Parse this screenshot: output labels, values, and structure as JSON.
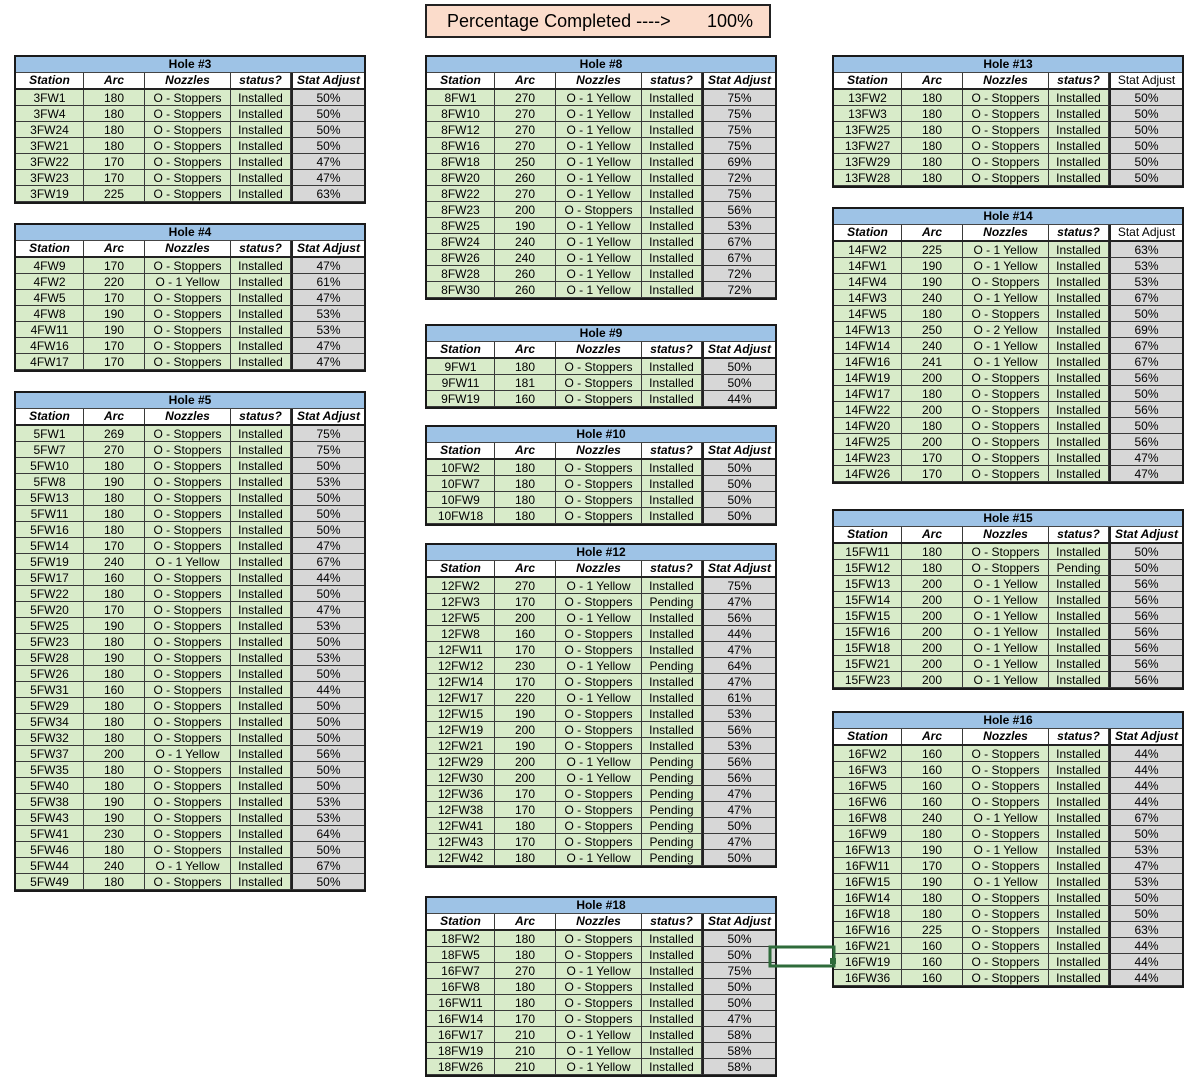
{
  "banner": {
    "label": "Percentage Completed ---->",
    "value": "100%"
  },
  "columns": [
    "Station",
    "Arc",
    "Nozzles",
    "status?",
    "Stat Adjust"
  ],
  "holes": [
    {
      "title": "Hole #3",
      "adj_header_plain": false,
      "rows": [
        [
          "3FW1",
          "180",
          "O - Stoppers",
          "Installed",
          "50%"
        ],
        [
          "3FW4",
          "180",
          "O - Stoppers",
          "Installed",
          "50%"
        ],
        [
          "3FW24",
          "180",
          "O - Stoppers",
          "Installed",
          "50%"
        ],
        [
          "3FW21",
          "180",
          "O - Stoppers",
          "Installed",
          "50%"
        ],
        [
          "3FW22",
          "170",
          "O - Stoppers",
          "Installed",
          "47%"
        ],
        [
          "3FW23",
          "170",
          "O - Stoppers",
          "Installed",
          "47%"
        ],
        [
          "3FW19",
          "225",
          "O - Stoppers",
          "Installed",
          "63%"
        ]
      ]
    },
    {
      "title": "Hole #4",
      "adj_header_plain": false,
      "rows": [
        [
          "4FW9",
          "170",
          "O - Stoppers",
          "Installed",
          "47%"
        ],
        [
          "4FW2",
          "220",
          "O - 1 Yellow",
          "Installed",
          "61%"
        ],
        [
          "4FW5",
          "170",
          "O - Stoppers",
          "Installed",
          "47%"
        ],
        [
          "4FW8",
          "190",
          "O - Stoppers",
          "Installed",
          "53%"
        ],
        [
          "4FW11",
          "190",
          "O - Stoppers",
          "Installed",
          "53%"
        ],
        [
          "4FW16",
          "170",
          "O - Stoppers",
          "Installed",
          "47%"
        ],
        [
          "4FW17",
          "170",
          "O - Stoppers",
          "Installed",
          "47%"
        ]
      ]
    },
    {
      "title": "Hole #5",
      "adj_header_plain": false,
      "rows": [
        [
          "5FW1",
          "269",
          "O - Stoppers",
          "Installed",
          "75%"
        ],
        [
          "5FW7",
          "270",
          "O - Stoppers",
          "Installed",
          "75%"
        ],
        [
          "5FW10",
          "180",
          "O - Stoppers",
          "Installed",
          "50%"
        ],
        [
          "5FW8",
          "190",
          "O - Stoppers",
          "Installed",
          "53%"
        ],
        [
          "5FW13",
          "180",
          "O - Stoppers",
          "Installed",
          "50%"
        ],
        [
          "5FW11",
          "180",
          "O - Stoppers",
          "Installed",
          "50%"
        ],
        [
          "5FW16",
          "180",
          "O - Stoppers",
          "Installed",
          "50%"
        ],
        [
          "5FW14",
          "170",
          "O - Stoppers",
          "Installed",
          "47%"
        ],
        [
          "5FW19",
          "240",
          "O - 1 Yellow",
          "Installed",
          "67%"
        ],
        [
          "5FW17",
          "160",
          "O - Stoppers",
          "Installed",
          "44%"
        ],
        [
          "5FW22",
          "180",
          "O - Stoppers",
          "Installed",
          "50%"
        ],
        [
          "5FW20",
          "170",
          "O - Stoppers",
          "Installed",
          "47%"
        ],
        [
          "5FW25",
          "190",
          "O - Stoppers",
          "Installed",
          "53%"
        ],
        [
          "5FW23",
          "180",
          "O - Stoppers",
          "Installed",
          "50%"
        ],
        [
          "5FW28",
          "190",
          "O - Stoppers",
          "Installed",
          "53%"
        ],
        [
          "5FW26",
          "180",
          "O - Stoppers",
          "Installed",
          "50%"
        ],
        [
          "5FW31",
          "160",
          "O - Stoppers",
          "Installed",
          "44%"
        ],
        [
          "5FW29",
          "180",
          "O - Stoppers",
          "Installed",
          "50%"
        ],
        [
          "5FW34",
          "180",
          "O - Stoppers",
          "Installed",
          "50%"
        ],
        [
          "5FW32",
          "180",
          "O - Stoppers",
          "Installed",
          "50%"
        ],
        [
          "5FW37",
          "200",
          "O - 1 Yellow",
          "Installed",
          "56%"
        ],
        [
          "5FW35",
          "180",
          "O - Stoppers",
          "Installed",
          "50%"
        ],
        [
          "5FW40",
          "180",
          "O - Stoppers",
          "Installed",
          "50%"
        ],
        [
          "5FW38",
          "190",
          "O - Stoppers",
          "Installed",
          "53%"
        ],
        [
          "5FW43",
          "190",
          "O - Stoppers",
          "Installed",
          "53%"
        ],
        [
          "5FW41",
          "230",
          "O - Stoppers",
          "Installed",
          "64%"
        ],
        [
          "5FW46",
          "180",
          "O - Stoppers",
          "Installed",
          "50%"
        ],
        [
          "5FW44",
          "240",
          "O - 1 Yellow",
          "Installed",
          "67%"
        ],
        [
          "5FW49",
          "180",
          "O - Stoppers",
          "Installed",
          "50%"
        ]
      ]
    },
    {
      "title": "Hole #8",
      "adj_header_plain": false,
      "rows": [
        [
          "8FW1",
          "270",
          "O - 1 Yellow",
          "Installed",
          "75%"
        ],
        [
          "8FW10",
          "270",
          "O - 1 Yellow",
          "Installed",
          "75%"
        ],
        [
          "8FW12",
          "270",
          "O - 1 Yellow",
          "Installed",
          "75%"
        ],
        [
          "8FW16",
          "270",
          "O - 1 Yellow",
          "Installed",
          "75%"
        ],
        [
          "8FW18",
          "250",
          "O - 1 Yellow",
          "Installed",
          "69%"
        ],
        [
          "8FW20",
          "260",
          "O - 1 Yellow",
          "Installed",
          "72%"
        ],
        [
          "8FW22",
          "270",
          "O - 1 Yellow",
          "Installed",
          "75%"
        ],
        [
          "8FW23",
          "200",
          "O - Stoppers",
          "Installed",
          "56%"
        ],
        [
          "8FW25",
          "190",
          "O - 1 Yellow",
          "Installed",
          "53%"
        ],
        [
          "8FW24",
          "240",
          "O - 1 Yellow",
          "Installed",
          "67%"
        ],
        [
          "8FW26",
          "240",
          "O - 1 Yellow",
          "Installed",
          "67%"
        ],
        [
          "8FW28",
          "260",
          "O - 1 Yellow",
          "Installed",
          "72%"
        ],
        [
          "8FW30",
          "260",
          "O - 1 Yellow",
          "Installed",
          "72%"
        ]
      ]
    },
    {
      "title": "Hole #9",
      "adj_header_plain": false,
      "rows": [
        [
          "9FW1",
          "180",
          "O - Stoppers",
          "Installed",
          "50%"
        ],
        [
          "9FW11",
          "181",
          "O - Stoppers",
          "Installed",
          "50%"
        ],
        [
          "9FW19",
          "160",
          "O - Stoppers",
          "Installed",
          "44%"
        ]
      ]
    },
    {
      "title": "Hole #10",
      "adj_header_plain": false,
      "rows": [
        [
          "10FW2",
          "180",
          "O - Stoppers",
          "Installed",
          "50%"
        ],
        [
          "10FW7",
          "180",
          "O - Stoppers",
          "Installed",
          "50%"
        ],
        [
          "10FW9",
          "180",
          "O - Stoppers",
          "Installed",
          "50%"
        ],
        [
          "10FW18",
          "180",
          "O - Stoppers",
          "Installed",
          "50%"
        ]
      ]
    },
    {
      "title": "Hole #12",
      "adj_header_plain": false,
      "rows": [
        [
          "12FW2",
          "270",
          "O - 1 Yellow",
          "Installed",
          "75%"
        ],
        [
          "12FW3",
          "170",
          "O - Stoppers",
          "Pending",
          "47%"
        ],
        [
          "12FW5",
          "200",
          "O - 1 Yellow",
          "Installed",
          "56%"
        ],
        [
          "12FW8",
          "160",
          "O - Stoppers",
          "Installed",
          "44%"
        ],
        [
          "12FW11",
          "170",
          "O - Stoppers",
          "Installed",
          "47%"
        ],
        [
          "12FW12",
          "230",
          "O - 1 Yellow",
          "Pending",
          "64%"
        ],
        [
          "12FW14",
          "170",
          "O - Stoppers",
          "Installed",
          "47%"
        ],
        [
          "12FW17",
          "220",
          "O - 1 Yellow",
          "Installed",
          "61%"
        ],
        [
          "12FW15",
          "190",
          "O - Stoppers",
          "Installed",
          "53%"
        ],
        [
          "12FW19",
          "200",
          "O - Stoppers",
          "Installed",
          "56%"
        ],
        [
          "12FW21",
          "190",
          "O - Stoppers",
          "Installed",
          "53%"
        ],
        [
          "12FW29",
          "200",
          "O - 1 Yellow",
          "Pending",
          "56%"
        ],
        [
          "12FW30",
          "200",
          "O - 1 Yellow",
          "Pending",
          "56%"
        ],
        [
          "12FW36",
          "170",
          "O - Stoppers",
          "Pending",
          "47%"
        ],
        [
          "12FW38",
          "170",
          "O - Stoppers",
          "Pending",
          "47%"
        ],
        [
          "12FW41",
          "180",
          "O - Stoppers",
          "Pending",
          "50%"
        ],
        [
          "12FW43",
          "170",
          "O - Stoppers",
          "Pending",
          "47%"
        ],
        [
          "12FW42",
          "180",
          "O - 1 Yellow",
          "Pending",
          "50%"
        ]
      ]
    },
    {
      "title": "Hole #18",
      "adj_header_plain": false,
      "rows": [
        [
          "18FW2",
          "180",
          "O - Stoppers",
          "Installed",
          "50%"
        ],
        [
          "18FW5",
          "180",
          "O - Stoppers",
          "Installed",
          "50%"
        ],
        [
          "16FW7",
          "270",
          "O - 1 Yellow",
          "Installed",
          "75%"
        ],
        [
          "16FW8",
          "180",
          "O - Stoppers",
          "Installed",
          "50%"
        ],
        [
          "16FW11",
          "180",
          "O - Stoppers",
          "Installed",
          "50%"
        ],
        [
          "16FW14",
          "170",
          "O - Stoppers",
          "Installed",
          "47%"
        ],
        [
          "16FW17",
          "210",
          "O - 1 Yellow",
          "Installed",
          "58%"
        ],
        [
          "18FW19",
          "210",
          "O - 1 Yellow",
          "Installed",
          "58%"
        ],
        [
          "18FW26",
          "210",
          "O - 1 Yellow",
          "Installed",
          "58%"
        ]
      ]
    },
    {
      "title": "Hole #13",
      "adj_header_plain": true,
      "rows": [
        [
          "13FW2",
          "180",
          "O - Stoppers",
          "Installed",
          "50%"
        ],
        [
          "13FW3",
          "180",
          "O - Stoppers",
          "Installed",
          "50%"
        ],
        [
          "13FW25",
          "180",
          "O - Stoppers",
          "Installed",
          "50%"
        ],
        [
          "13FW27",
          "180",
          "O - Stoppers",
          "Installed",
          "50%"
        ],
        [
          "13FW29",
          "180",
          "O - Stoppers",
          "Installed",
          "50%"
        ],
        [
          "13FW28",
          "180",
          "O - Stoppers",
          "Installed",
          "50%"
        ]
      ]
    },
    {
      "title": "Hole #14",
      "adj_header_plain": true,
      "rows": [
        [
          "14FW2",
          "225",
          "O - 1 Yellow",
          "Installed",
          "63%"
        ],
        [
          "14FW1",
          "190",
          "O - 1 Yellow",
          "Installed",
          "53%"
        ],
        [
          "14FW4",
          "190",
          "O - Stoppers",
          "Installed",
          "53%"
        ],
        [
          "14FW3",
          "240",
          "O - 1 Yellow",
          "Installed",
          "67%"
        ],
        [
          "14FW5",
          "180",
          "O - Stoppers",
          "Installed",
          "50%"
        ],
        [
          "14FW13",
          "250",
          "O - 2 Yellow",
          "Installed",
          "69%"
        ],
        [
          "14FW14",
          "240",
          "O - 1 Yellow",
          "Installed",
          "67%"
        ],
        [
          "14FW16",
          "241",
          "O - 1 Yellow",
          "Installed",
          "67%"
        ],
        [
          "14FW19",
          "200",
          "O - Stoppers",
          "Installed",
          "56%"
        ],
        [
          "14FW17",
          "180",
          "O - Stoppers",
          "Installed",
          "50%"
        ],
        [
          "14FW22",
          "200",
          "O - Stoppers",
          "Installed",
          "56%"
        ],
        [
          "14FW20",
          "180",
          "O - Stoppers",
          "Installed",
          "50%"
        ],
        [
          "14FW25",
          "200",
          "O - Stoppers",
          "Installed",
          "56%"
        ],
        [
          "14FW23",
          "170",
          "O - Stoppers",
          "Installed",
          "47%"
        ],
        [
          "14FW26",
          "170",
          "O - Stoppers",
          "Installed",
          "47%"
        ]
      ]
    },
    {
      "title": "Hole #15",
      "adj_header_plain": false,
      "rows": [
        [
          "15FW11",
          "180",
          "O - Stoppers",
          "Installed",
          "50%"
        ],
        [
          "15FW12",
          "180",
          "O - Stoppers",
          "Pending",
          "50%"
        ],
        [
          "15FW13",
          "200",
          "O - 1 Yellow",
          "Installed",
          "56%"
        ],
        [
          "15FW14",
          "200",
          "O - 1 Yellow",
          "Installed",
          "56%"
        ],
        [
          "15FW15",
          "200",
          "O - 1 Yellow",
          "Installed",
          "56%"
        ],
        [
          "15FW16",
          "200",
          "O - 1 Yellow",
          "Installed",
          "56%"
        ],
        [
          "15FW18",
          "200",
          "O - 1 Yellow",
          "Installed",
          "56%"
        ],
        [
          "15FW21",
          "200",
          "O - 1 Yellow",
          "Installed",
          "56%"
        ],
        [
          "15FW23",
          "200",
          "O - 1 Yellow",
          "Installed",
          "56%"
        ]
      ]
    },
    {
      "title": "Hole #16",
      "adj_header_plain": false,
      "rows": [
        [
          "16FW2",
          "160",
          "O - Stoppers",
          "Installed",
          "44%"
        ],
        [
          "16FW3",
          "160",
          "O - Stoppers",
          "Installed",
          "44%"
        ],
        [
          "16FW5",
          "160",
          "O - Stoppers",
          "Installed",
          "44%"
        ],
        [
          "16FW6",
          "160",
          "O - Stoppers",
          "Installed",
          "44%"
        ],
        [
          "16FW8",
          "240",
          "O - 1 Yellow",
          "Installed",
          "67%"
        ],
        [
          "16FW9",
          "180",
          "O - Stoppers",
          "Installed",
          "50%"
        ],
        [
          "16FW13",
          "190",
          "O - 1 Yellow",
          "Installed",
          "53%"
        ],
        [
          "16FW11",
          "170",
          "O - Stoppers",
          "Installed",
          "47%"
        ],
        [
          "16FW15",
          "190",
          "O - 1 Yellow",
          "Installed",
          "53%"
        ],
        [
          "16FW14",
          "180",
          "O - Stoppers",
          "Installed",
          "50%"
        ],
        [
          "16FW18",
          "180",
          "O - Stoppers",
          "Installed",
          "50%"
        ],
        [
          "16FW16",
          "225",
          "O - Stoppers",
          "Installed",
          "63%"
        ],
        [
          "16FW21",
          "160",
          "O - Stoppers",
          "Installed",
          "44%"
        ],
        [
          "16FW19",
          "160",
          "O - Stoppers",
          "Installed",
          "44%"
        ],
        [
          "16FW36",
          "160",
          "O - Stoppers",
          "Installed",
          "44%"
        ]
      ]
    }
  ]
}
